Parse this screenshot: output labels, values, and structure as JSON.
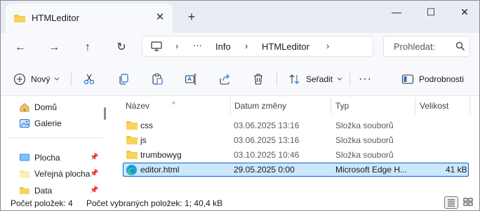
{
  "window": {
    "tab_title": "HTMLeditor",
    "tab_close": "✕",
    "new_tab": "+",
    "controls": {
      "minimize": "—",
      "maximize": "☐",
      "close": "✕"
    }
  },
  "nav": {
    "back": "←",
    "forward": "→",
    "up": "↑",
    "refresh": "↻",
    "more": "···",
    "crumbs": [
      "Info",
      "HTMLeditor"
    ],
    "sep": "›",
    "search_placeholder": "Prohledat:"
  },
  "commands": {
    "new_label": "Nový",
    "sort_label": "Seřadit",
    "more": "···",
    "details_label": "Podrobnosti"
  },
  "sidebar": {
    "items": [
      {
        "label": "Domů",
        "icon": "home-icon",
        "pinned": false
      },
      {
        "label": "Galerie",
        "icon": "gallery-icon",
        "pinned": false
      },
      {
        "label": "Plocha",
        "icon": "desktop-icon",
        "pinned": true
      },
      {
        "label": "Veřejná plocha",
        "icon": "folder-icon",
        "pinned": true
      },
      {
        "label": "Data",
        "icon": "folder-icon",
        "pinned": true
      }
    ]
  },
  "files": {
    "columns": [
      "Název",
      "Datum změny",
      "Typ",
      "Velikost"
    ],
    "sort_indicator": "^",
    "rows": [
      {
        "name": "css",
        "date": "03.06.2025 13:16",
        "type": "Složka souborů",
        "size": "",
        "icon": "folder-icon",
        "selected": false
      },
      {
        "name": "js",
        "date": "03.06.2025 13:16",
        "type": "Složka souborů",
        "size": "",
        "icon": "folder-icon",
        "selected": false
      },
      {
        "name": "trumbowyg",
        "date": "03.10.2025 10:46",
        "type": "Složka souborů",
        "size": "",
        "icon": "folder-icon",
        "selected": false
      },
      {
        "name": "editor.html",
        "date": "29.05.2025 0:00",
        "type": "Microsoft Edge H...",
        "size": "41 kB",
        "icon": "edge-icon",
        "selected": true
      }
    ]
  },
  "status": {
    "count": "Počet položek: 4",
    "selected": "Počet vybraných položek: 1; 40,4 kB"
  },
  "colors": {
    "accent": "#0a62c5",
    "selection": "#cce8ff",
    "folder": "#f4c542"
  }
}
